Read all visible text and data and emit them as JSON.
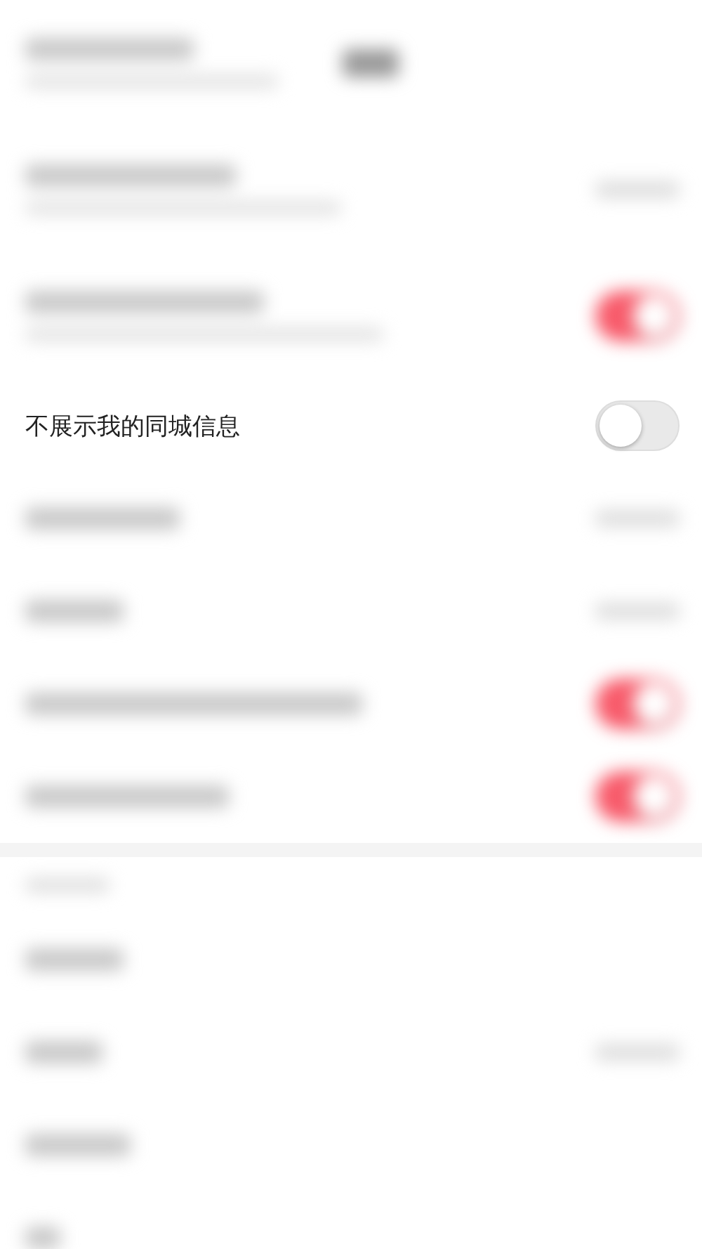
{
  "sections": [
    {
      "rows": [
        {
          "kind": "info",
          "blurred": true,
          "two_line": true
        },
        {
          "kind": "value",
          "blurred": true,
          "two_line": true
        },
        {
          "kind": "toggle",
          "blurred": true,
          "two_line": true,
          "on": true
        },
        {
          "kind": "toggle",
          "blurred": false,
          "two_line": false,
          "label": "不展示我的同城信息",
          "on": false
        },
        {
          "kind": "value",
          "blurred": true,
          "two_line": false
        },
        {
          "kind": "value",
          "blurred": true,
          "two_line": false
        },
        {
          "kind": "toggle",
          "blurred": true,
          "two_line": false,
          "on": true
        },
        {
          "kind": "toggle",
          "blurred": true,
          "two_line": false,
          "on": true
        }
      ]
    },
    {
      "rows": [
        {
          "kind": "link",
          "blurred": true,
          "two_line": false
        },
        {
          "kind": "value",
          "blurred": true,
          "two_line": false
        },
        {
          "kind": "link",
          "blurred": true,
          "two_line": false
        },
        {
          "kind": "link",
          "blurred": true,
          "two_line": false
        }
      ]
    }
  ]
}
